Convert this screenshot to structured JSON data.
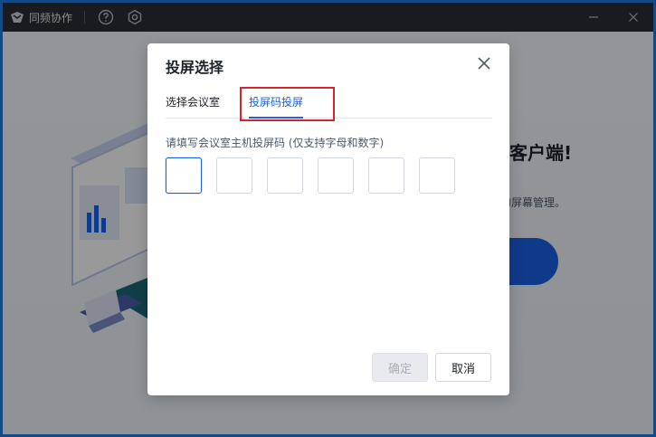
{
  "app": {
    "title": "同频协作"
  },
  "background": {
    "headline": "作客户端!",
    "sub": "效的屏幕管理。"
  },
  "dialog": {
    "title": "投屏选择",
    "tabs": [
      {
        "label": "选择会议室",
        "active": false
      },
      {
        "label": "投屏码投屏",
        "active": true
      }
    ],
    "code_label": "请填写会议室主机投屏码 (仅支持字母和数字)",
    "code_boxes": [
      "",
      "",
      "",
      "",
      "",
      ""
    ],
    "confirm_label": "确定",
    "cancel_label": "取消"
  },
  "colors": {
    "accent": "#1a62e6",
    "highlight": "#d9222a",
    "titlebar": "#2b2d33"
  }
}
